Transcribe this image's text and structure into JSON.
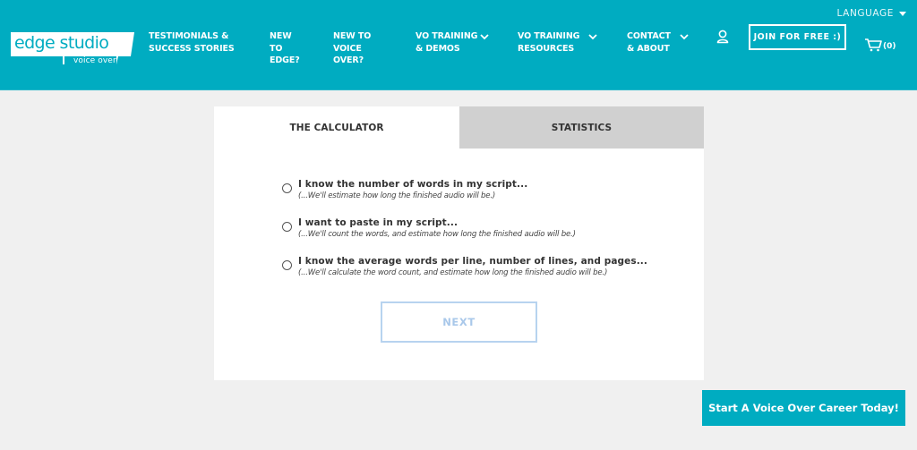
{
  "brand": {
    "name": "edge studio",
    "tagline": "voice over",
    "primary_color": "#00acc1"
  },
  "header": {
    "language_label": "LANGUAGE",
    "nav": [
      {
        "label": "TESTIMONIALS & SUCCESS STORIES",
        "lines": [
          "TESTIMONIALS &",
          "SUCCESS STORIES"
        ],
        "has_dropdown": false
      },
      {
        "label": "NEW TO EDGE?",
        "lines": [
          "NEW",
          "TO",
          "EDGE?"
        ],
        "has_dropdown": false
      },
      {
        "label": "NEW TO VOICE OVER?",
        "lines": [
          "NEW TO",
          "VOICE",
          "OVER?"
        ],
        "has_dropdown": false
      },
      {
        "label": "VO TRAINING & DEMOS",
        "lines": [
          "VO TRAINING",
          "& DEMOS"
        ],
        "has_dropdown": true
      },
      {
        "label": "VO TRAINING RESOURCES",
        "lines": [
          "VO TRAINING",
          "RESOURCES"
        ],
        "has_dropdown": true
      },
      {
        "label": "CONTACT & ABOUT",
        "lines": [
          "CONTACT",
          "& ABOUT"
        ],
        "has_dropdown": true
      }
    ],
    "join_label": "JOIN FOR FREE :)",
    "cart_count": "(0)",
    "icons": {
      "account": "user-icon",
      "cart": "cart-icon",
      "dropdown": "chevron-down-icon",
      "language": "caret-down-icon"
    }
  },
  "calculator": {
    "tabs": [
      {
        "label": "THE CALCULATOR",
        "active": true
      },
      {
        "label": "STATISTICS",
        "active": false
      }
    ],
    "options": [
      {
        "title": "I know the number of words in my script...",
        "subtitle": "(...We'll estimate how long the finished audio will be.)",
        "selected": false
      },
      {
        "title": "I want to paste in my script...",
        "subtitle": "(...We'll count the words, and estimate how long the finished audio will be.)",
        "selected": false
      },
      {
        "title": "I know the average words per line, number of lines, and pages...",
        "subtitle": "(...We'll calculate the word count, and estimate how long the finished audio will be.)",
        "selected": false
      }
    ],
    "next_label": "NEXT"
  },
  "cta": {
    "label": "Start A Voice Over Career Today!"
  }
}
